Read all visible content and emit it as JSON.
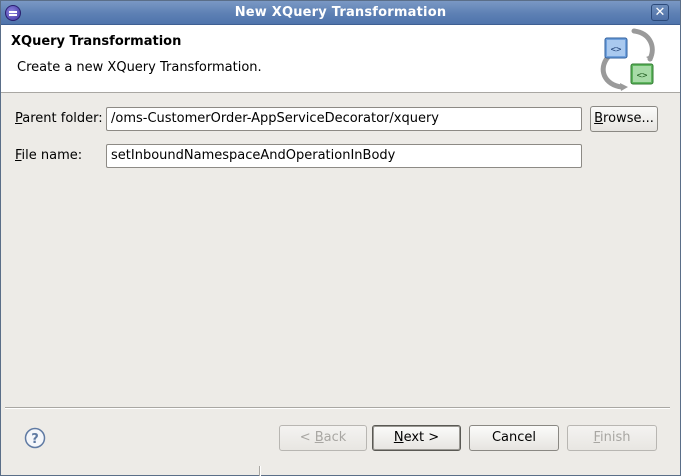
{
  "window": {
    "title": "New XQuery Transformation",
    "close_glyph": "✕"
  },
  "banner": {
    "title": "XQuery Transformation",
    "description": "Create a new XQuery Transformation.",
    "graphic_icon": "xquery-transform-icon"
  },
  "form": {
    "parent_folder": {
      "label_mnemonic": "P",
      "label_rest": "arent folder:",
      "value": "/oms-CustomerOrder-AppServiceDecorator/xquery"
    },
    "file_name": {
      "label_mnemonic": "F",
      "label_rest": "ile name:",
      "value": "setInboundNamespaceAndOperationInBody"
    },
    "browse": {
      "label_mnemonic": "B",
      "label_rest": "rowse..."
    }
  },
  "footer": {
    "help_icon": "help-icon",
    "back": {
      "prefix": "< ",
      "mnemonic": "B",
      "rest": "ack"
    },
    "next": {
      "mnemonic": "N",
      "rest": "ext >"
    },
    "cancel": {
      "label": "Cancel"
    },
    "finish": {
      "mnemonic": "F",
      "rest": "inish"
    }
  }
}
